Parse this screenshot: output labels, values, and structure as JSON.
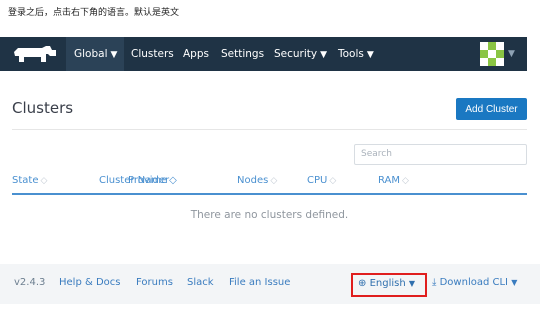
{
  "caption": "登录之后，点击右下角的语言。默认是英文",
  "nav": {
    "global": "Global",
    "clusters": "Clusters",
    "apps": "Apps",
    "settings": "Settings",
    "security": "Security",
    "tools": "Tools"
  },
  "page": {
    "title": "Clusters",
    "add_button": "Add Cluster",
    "search_placeholder": "Search"
  },
  "table": {
    "columns": [
      "State",
      "Cluster Name",
      "Provider",
      "Nodes",
      "CPU",
      "RAM"
    ],
    "empty_text": "There are no clusters defined."
  },
  "footer": {
    "version": "v2.4.3",
    "help": "Help & Docs",
    "forums": "Forums",
    "slack": "Slack",
    "issue": "File an Issue",
    "language": "English",
    "download": "Download CLI"
  },
  "colors": {
    "navbar": "#1f3345",
    "primary": "#1a78c2",
    "link": "#3a7cbf",
    "highlight": "#e01e1e"
  },
  "icons": [
    "rancher-logo-icon",
    "chevron-down-icon",
    "sort-icon",
    "globe-icon",
    "download-icon",
    "avatar-identicon"
  ]
}
